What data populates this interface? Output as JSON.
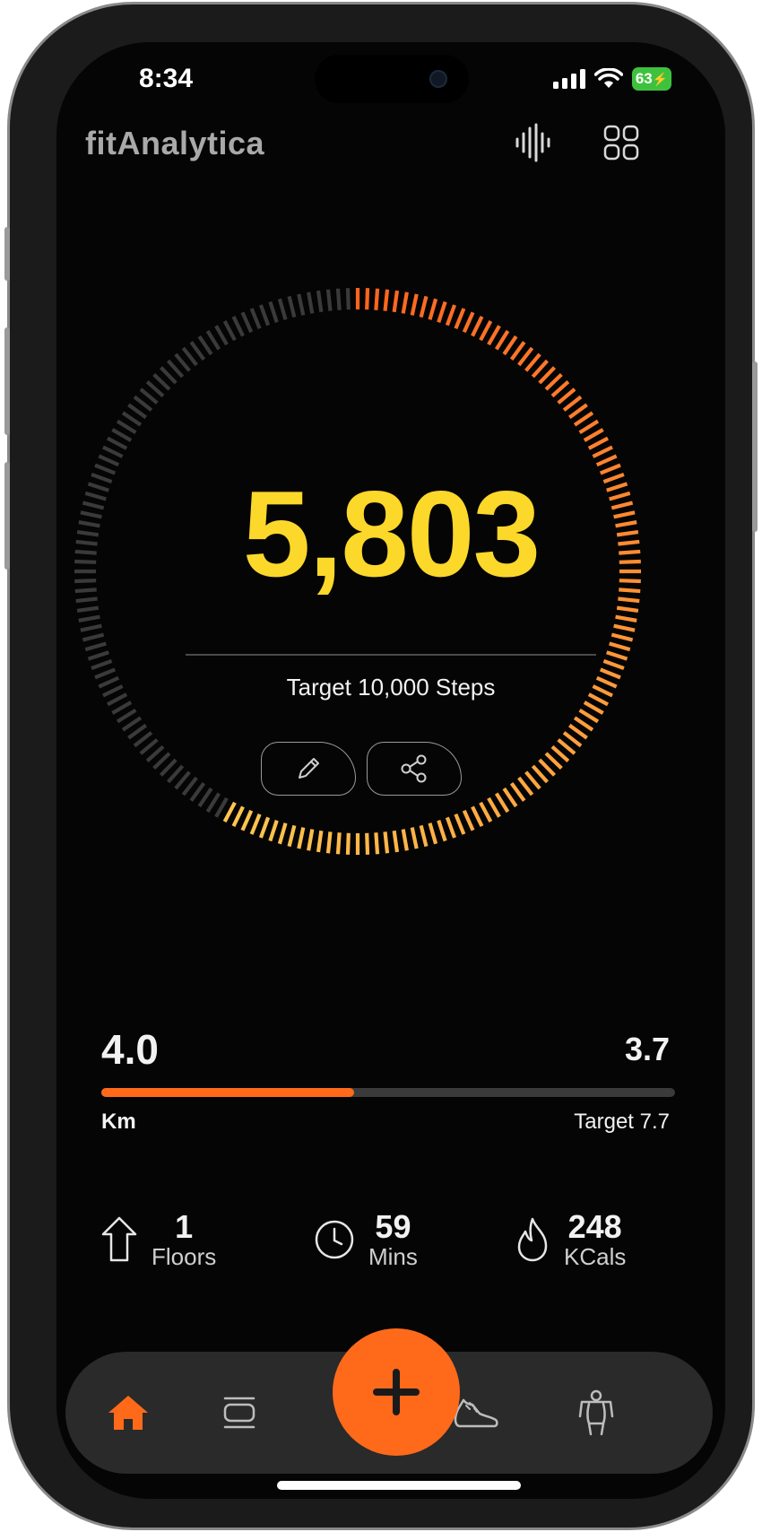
{
  "status_bar": {
    "time": "8:34",
    "battery": "63"
  },
  "header": {
    "app_title": "fitAnalytica",
    "icons": [
      "audio-waveform-icon",
      "grid-icon"
    ]
  },
  "steps": {
    "count": "5,803",
    "target_label": "Target 10,000 Steps",
    "progress": 0.58
  },
  "actions": [
    "edit-icon",
    "share-icon"
  ],
  "distance": {
    "value": "4.0",
    "unit": "Km",
    "remaining": "3.7",
    "target_label": "Target 7.7",
    "progress": 0.44
  },
  "stats": [
    {
      "icon": "arrow-up-icon",
      "value": "1",
      "label": "Floors"
    },
    {
      "icon": "clock-icon",
      "value": "59",
      "label": "Mins"
    },
    {
      "icon": "flame-icon",
      "value": "248",
      "label": "KCals"
    }
  ],
  "nav": {
    "items": [
      "home-icon",
      "cards-icon",
      "add-icon",
      "sneaker-icon",
      "person-icon"
    ],
    "active": "home-icon"
  },
  "colors": {
    "accent": "#ff6a1a",
    "steps_text": "#fbd82a",
    "ring_inactive": "#3a3a3a",
    "background": "#050505"
  }
}
